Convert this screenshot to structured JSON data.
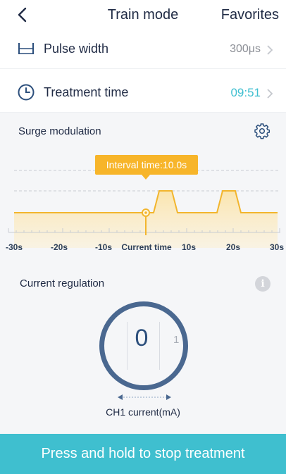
{
  "header": {
    "back_icon": "back-chevron-icon",
    "title": "Train mode",
    "favorites_label": "Favorites"
  },
  "settings": {
    "pulse_width": {
      "icon": "pulse-width-icon",
      "label": "Pulse width",
      "value": "300μs"
    },
    "treatment_time": {
      "icon": "clock-icon",
      "label": "Treatment time",
      "value": "09:51"
    }
  },
  "surge": {
    "title": "Surge modulation",
    "settings_icon": "gear-icon",
    "tooltip": "Interval time:10.0s",
    "x_ticks": [
      "-30s",
      "-20s",
      "-10s",
      "Current time",
      "10s",
      "20s",
      "30s"
    ]
  },
  "current_regulation": {
    "title": "Current regulation",
    "info_icon": "info-icon",
    "value": "0",
    "next_value": "1",
    "label": "CH1 current(mA)"
  },
  "stop_button": {
    "label": "Press and hold to stop treatment"
  },
  "colors": {
    "accent": "#3fbfcf",
    "time_value": "#3fbfd0",
    "surge_line": "#f2b52d",
    "dial_ring": "#4a6890",
    "text_dark": "#1f2a44"
  }
}
